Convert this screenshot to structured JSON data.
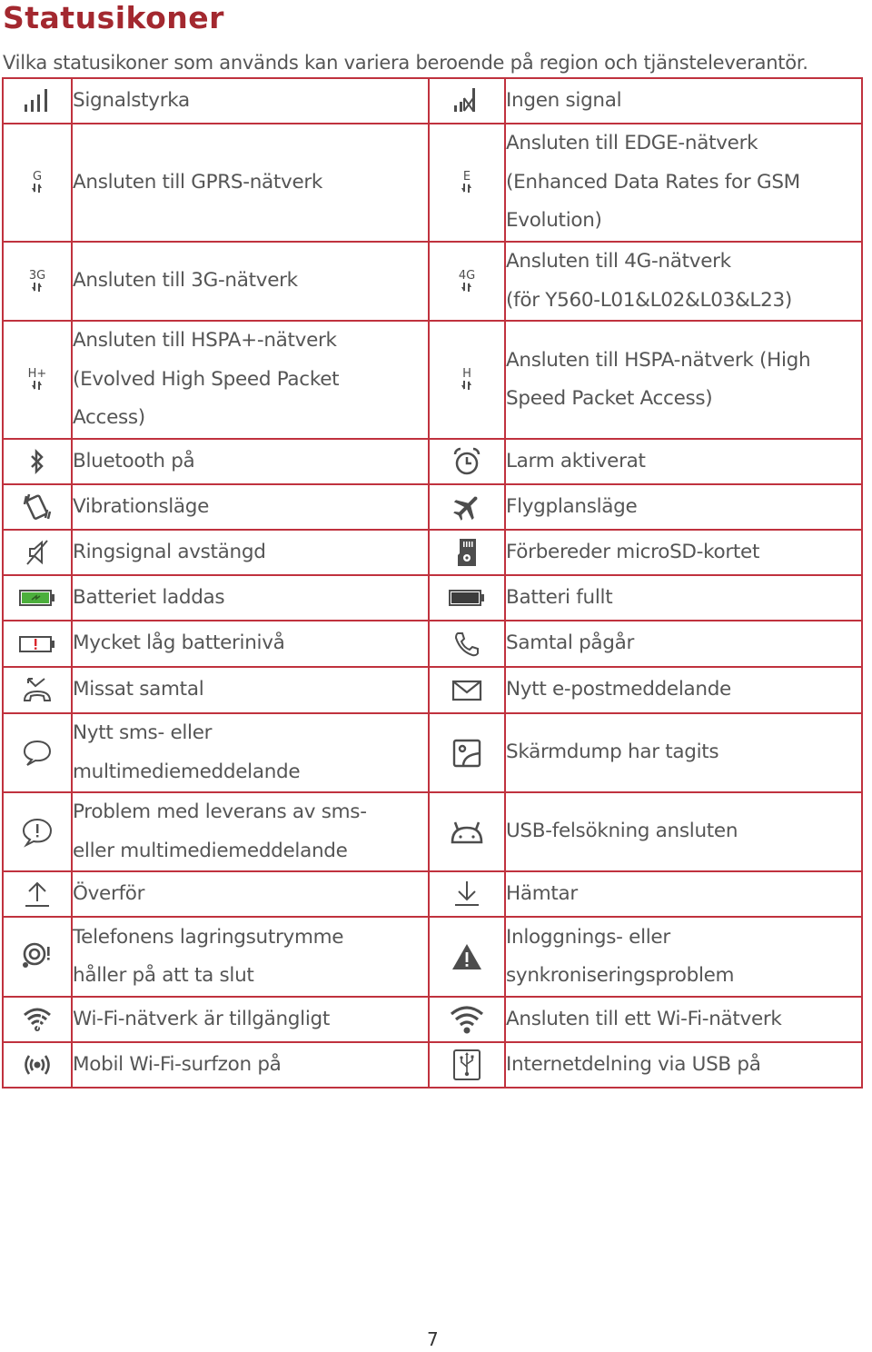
{
  "document": {
    "title": "Statusikoner",
    "subtitle": "Vilka statusikoner som används kan variera beroende på region och tjänsteleverantör.",
    "page_number": "7"
  },
  "colors": {
    "title": "#a3282f",
    "table_border": "#c0323e",
    "icon": "#4d4d4d",
    "battery_charging_fill": "#4caf3c",
    "battery_low_mark": "#d9262c"
  },
  "rows": [
    {
      "left": {
        "icon": "signal-strength-icon",
        "lines": [
          "Signalstyrka"
        ]
      },
      "right": {
        "icon": "no-signal-icon",
        "lines": [
          "Ingen signal"
        ]
      }
    },
    {
      "left": {
        "icon": "gprs-icon",
        "icon_label": "G",
        "lines": [
          "Ansluten till GPRS-nätverk"
        ]
      },
      "right": {
        "icon": "edge-icon",
        "icon_label": "E",
        "lines": [
          "Ansluten till EDGE-nätverk",
          "(Enhanced Data Rates for GSM",
          "Evolution)"
        ]
      }
    },
    {
      "left": {
        "icon": "3g-icon",
        "icon_label": "3G",
        "lines": [
          "Ansluten till 3G-nätverk"
        ]
      },
      "right": {
        "icon": "4g-icon",
        "icon_label": "4G",
        "lines": [
          "Ansluten till 4G-nätverk",
          "(för Y560-L01&L02&L03&L23)"
        ]
      }
    },
    {
      "left": {
        "icon": "hspa-plus-icon",
        "icon_label": "H+",
        "lines": [
          "Ansluten till HSPA+-nätverk",
          "(Evolved High Speed Packet",
          "Access)"
        ]
      },
      "right": {
        "icon": "hspa-icon",
        "icon_label": "H",
        "lines": [
          "Ansluten till HSPA-nätverk (High",
          "Speed Packet Access)"
        ]
      }
    },
    {
      "left": {
        "icon": "bluetooth-icon",
        "lines": [
          "Bluetooth på"
        ]
      },
      "right": {
        "icon": "alarm-icon",
        "lines": [
          "Larm aktiverat"
        ]
      }
    },
    {
      "left": {
        "icon": "vibrate-icon",
        "lines": [
          "Vibrationsläge"
        ]
      },
      "right": {
        "icon": "airplane-icon",
        "lines": [
          "Flygplansläge"
        ]
      }
    },
    {
      "left": {
        "icon": "ringer-off-icon",
        "lines": [
          "Ringsignal avstängd"
        ]
      },
      "right": {
        "icon": "microsd-icon",
        "lines": [
          "Förbereder microSD-kortet"
        ]
      }
    },
    {
      "left": {
        "icon": "battery-charging-icon",
        "lines": [
          "Batteriet laddas"
        ]
      },
      "right": {
        "icon": "battery-full-icon",
        "lines": [
          "Batteri fullt"
        ]
      }
    },
    {
      "left": {
        "icon": "battery-low-icon",
        "lines": [
          "Mycket låg batterinivå"
        ]
      },
      "right": {
        "icon": "call-in-progress-icon",
        "lines": [
          "Samtal pågår"
        ]
      }
    },
    {
      "left": {
        "icon": "missed-call-icon",
        "lines": [
          "Missat samtal"
        ]
      },
      "right": {
        "icon": "email-icon",
        "lines": [
          "Nytt e-postmeddelande"
        ]
      }
    },
    {
      "left": {
        "icon": "message-icon",
        "lines": [
          "Nytt sms- eller",
          "multimediemeddelande"
        ]
      },
      "right": {
        "icon": "screenshot-icon",
        "lines": [
          "Skärmdump har tagits"
        ]
      }
    },
    {
      "left": {
        "icon": "message-error-icon",
        "lines": [
          "Problem med leverans av sms-",
          "eller multimediemeddelande"
        ]
      },
      "right": {
        "icon": "android-debug-icon",
        "lines": [
          "USB-felsökning ansluten"
        ]
      }
    },
    {
      "left": {
        "icon": "upload-icon",
        "lines": [
          "Överför"
        ]
      },
      "right": {
        "icon": "download-icon",
        "lines": [
          "Hämtar"
        ]
      }
    },
    {
      "left": {
        "icon": "storage-low-icon",
        "lines": [
          "Telefonens lagringsutrymme",
          "håller på att ta slut"
        ]
      },
      "right": {
        "icon": "warning-icon",
        "lines": [
          "Inloggnings- eller",
          "synkroniseringsproblem"
        ]
      }
    },
    {
      "left": {
        "icon": "wifi-available-icon",
        "lines": [
          "Wi-Fi-nätverk är tillgängligt"
        ]
      },
      "right": {
        "icon": "wifi-connected-icon",
        "lines": [
          "Ansluten till ett Wi-Fi-nätverk"
        ]
      }
    },
    {
      "left": {
        "icon": "hotspot-icon",
        "lines": [
          "Mobil Wi-Fi-surfzon på"
        ]
      },
      "right": {
        "icon": "usb-tethering-icon",
        "lines": [
          "Internetdelning via USB på"
        ]
      }
    }
  ]
}
